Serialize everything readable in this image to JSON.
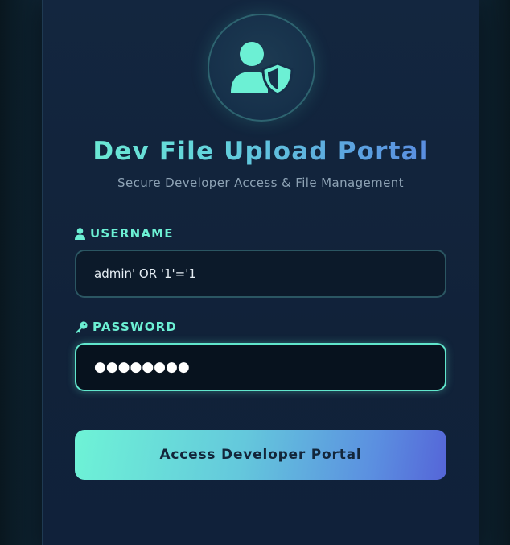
{
  "colors": {
    "accent": "#6cf0d4",
    "accent_blue": "#5a7fe0",
    "card_bg": "#13263f",
    "page_bg": "#0b1a24",
    "input_bg": "#0c1a2a",
    "subtitle": "#8ea3b5",
    "button_text": "#13263a"
  },
  "header": {
    "icon": "user-shield-icon",
    "title": "Dev File Upload Portal",
    "subtitle": "Secure Developer Access & File Management"
  },
  "form": {
    "username": {
      "icon": "user-icon",
      "label": "USERNAME",
      "value": "admin' OR '1'='1"
    },
    "password": {
      "icon": "key-icon",
      "label": "PASSWORD",
      "masked_value": "●●●●●●●●",
      "focused": true
    },
    "submit_label": "Access Developer Portal"
  }
}
